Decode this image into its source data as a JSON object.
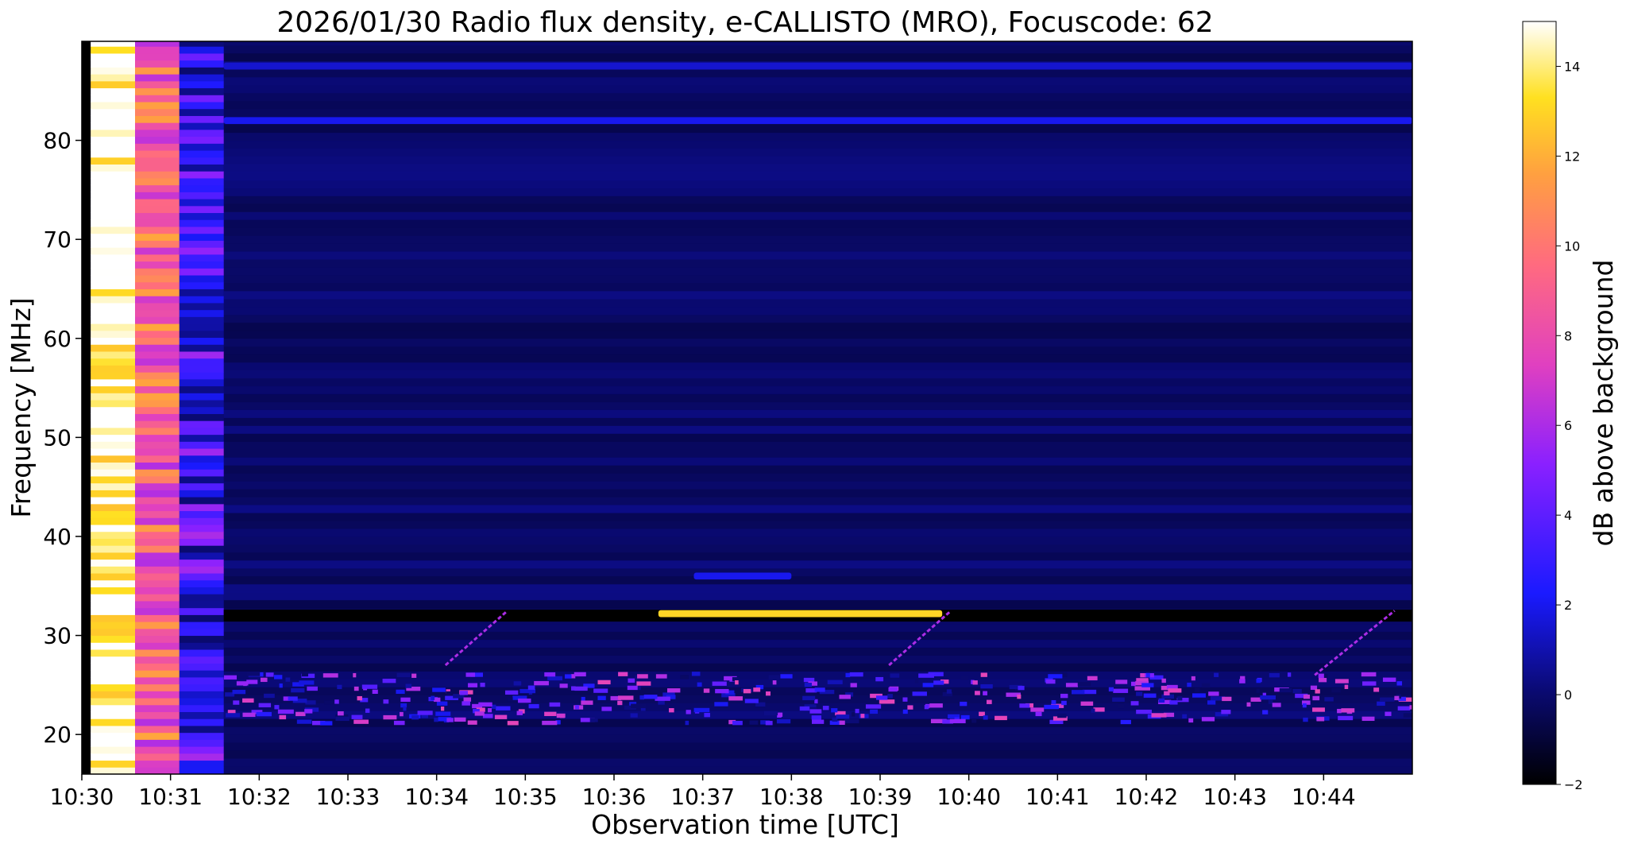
{
  "chart_data": {
    "type": "heatmap",
    "title": "2026/01/30  Radio flux density, e-CALLISTO (MRO), Focuscode: 62",
    "xlabel": "Observation time [UTC]",
    "ylabel": "Frequency [MHz]",
    "x_unit": "minutes after 10:30 UTC",
    "xlim": [
      0,
      15
    ],
    "ylim": [
      16,
      90
    ],
    "x_ticks": [
      0,
      1,
      2,
      3,
      4,
      5,
      6,
      7,
      8,
      9,
      10,
      11,
      12,
      13,
      14
    ],
    "x_tick_labels": [
      "10:30",
      "10:31",
      "10:32",
      "10:33",
      "10:34",
      "10:35",
      "10:36",
      "10:37",
      "10:38",
      "10:39",
      "10:40",
      "10:41",
      "10:42",
      "10:43",
      "10:44"
    ],
    "y_ticks": [
      20,
      30,
      40,
      50,
      60,
      70,
      80
    ],
    "y_tick_labels": [
      "20",
      "30",
      "40",
      "50",
      "60",
      "70",
      "80"
    ],
    "colormap": "gnuplot2",
    "colorbar": {
      "label": "dB above background",
      "range": [
        -2,
        15
      ],
      "ticks": [
        -2,
        0,
        2,
        4,
        6,
        8,
        10,
        12,
        14
      ],
      "tick_labels": [
        "−2",
        "0",
        "2",
        "4",
        "6",
        "8",
        "10",
        "12",
        "14"
      ]
    },
    "calibration_columns": [
      {
        "x_start": 0.1,
        "x_end": 0.6,
        "level_db": 15
      },
      {
        "x_start": 0.6,
        "x_end": 1.1,
        "level_db": 9
      },
      {
        "x_start": 1.1,
        "x_end": 1.6,
        "level_db": 3
      }
    ],
    "background_level_db": 0,
    "features": [
      {
        "kind": "dark_band",
        "freq": 32,
        "x_start": 1.6,
        "x_end": 15,
        "level_db": -2
      },
      {
        "kind": "interference_band",
        "freq_range": [
          21,
          26
        ],
        "x_start": 1.6,
        "x_end": 15,
        "level_db": 3
      },
      {
        "kind": "horizontal_streak",
        "freq": 32.2,
        "x_start": 6.5,
        "x_end": 9.7,
        "level_db": 13
      },
      {
        "kind": "horizontal_streak",
        "freq": 36,
        "x_start": 6.9,
        "x_end": 8.0,
        "level_db": 2
      },
      {
        "kind": "drifting_burst",
        "x_start": 4.1,
        "x_end": 4.8,
        "freq_start": 27,
        "freq_end": 32.5,
        "level_db": 6
      },
      {
        "kind": "drifting_burst",
        "x_start": 9.1,
        "x_end": 9.8,
        "freq_start": 27,
        "freq_end": 32.5,
        "level_db": 6
      },
      {
        "kind": "drifting_burst",
        "x_start": 13.9,
        "x_end": 14.8,
        "freq_start": 26,
        "freq_end": 32.5,
        "level_db": 6
      },
      {
        "kind": "horizontal_streak",
        "freq": 82,
        "x_start": 1.6,
        "x_end": 15,
        "level_db": 2
      },
      {
        "kind": "horizontal_streak",
        "freq": 87.5,
        "x_start": 1.6,
        "x_end": 15,
        "level_db": 1.5
      }
    ]
  }
}
